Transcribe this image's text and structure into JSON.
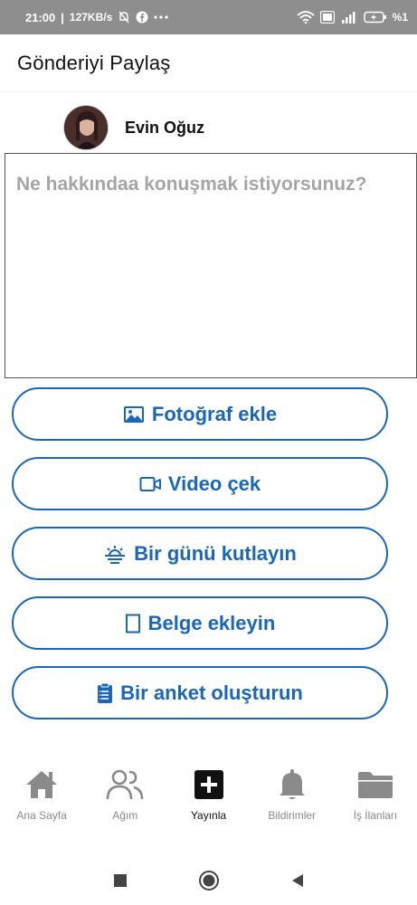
{
  "status_bar": {
    "time": "21:00",
    "speed": "127KB/s",
    "battery": "%1"
  },
  "header": {
    "title": "Gönderiyi Paylaş"
  },
  "user": {
    "name": "Evin Oğuz"
  },
  "composer": {
    "placeholder": "Ne hakkındaa konuşmak istiyorsunuz?"
  },
  "actions": [
    {
      "label": "Fotoğraf ekle",
      "icon": "image-icon"
    },
    {
      "label": "Video çek",
      "icon": "video-icon"
    },
    {
      "label": "Bir günü kutlayın",
      "icon": "sunrise-icon"
    },
    {
      "label": "Belge ekleyin",
      "icon": "document-icon"
    },
    {
      "label": "Bir anket oluşturun",
      "icon": "clipboard-icon"
    }
  ],
  "bottom_nav": [
    {
      "label": "Ana Sayfa",
      "icon": "home-icon",
      "active": false
    },
    {
      "label": "Ağım",
      "icon": "network-icon",
      "active": false
    },
    {
      "label": "Yayınla",
      "icon": "plus-icon",
      "active": true
    },
    {
      "label": "Bildirimler",
      "icon": "bell-icon",
      "active": false
    },
    {
      "label": "İş İlanları",
      "icon": "folder-icon",
      "active": false
    }
  ],
  "colors": {
    "accent": "#1a66b8",
    "status_bar": "#8e8e8e",
    "placeholder": "#a5a5a5"
  }
}
